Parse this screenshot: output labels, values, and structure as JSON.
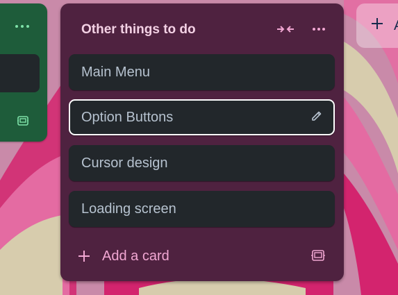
{
  "board": {
    "background_colors": {
      "base": "#c98aa9",
      "stripe_red": "#d3246e",
      "stripe_pink": "#e46ba2",
      "pale": "#d7ccad"
    }
  },
  "left_list": {
    "color": "#1e5c3a",
    "menu_icon": "ellipsis-icon",
    "footer_icon": "card-template-icon"
  },
  "add_list": {
    "icon": "plus-icon",
    "label": "A"
  },
  "list": {
    "title": "Other things to do",
    "color": "#4f2240",
    "title_color": "#f3d1e4",
    "accent_color": "#f2a7d3",
    "header_icons": [
      "collapse-icon",
      "ellipsis-icon"
    ],
    "cards": [
      {
        "title": "Main Menu",
        "active": false
      },
      {
        "title": "Option Buttons",
        "active": true,
        "icon": "pencil-icon"
      },
      {
        "title": "Cursor design",
        "active": false
      },
      {
        "title": "Loading screen",
        "active": false
      }
    ],
    "add_card_label": "Add a card",
    "footer_icon": "card-template-icon"
  }
}
